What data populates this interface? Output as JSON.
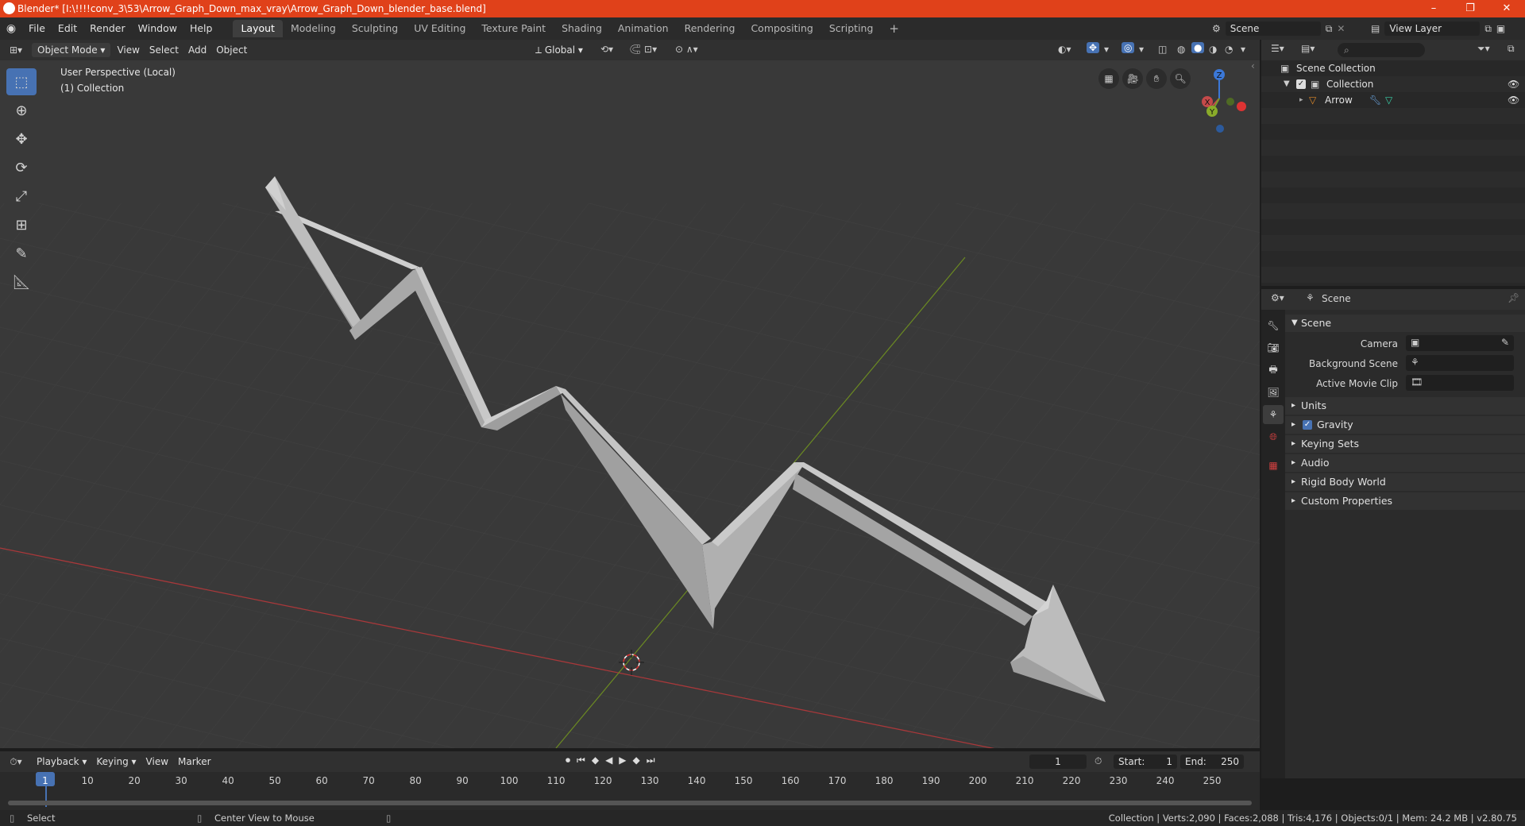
{
  "window": {
    "title": "Blender* [I:\\!!!!conv_3\\53\\Arrow_Graph_Down_max_vray\\Arrow_Graph_Down_blender_base.blend]",
    "controls": [
      "–",
      "❐",
      "✕"
    ]
  },
  "menu": [
    "File",
    "Edit",
    "Render",
    "Window",
    "Help"
  ],
  "workspaces": [
    {
      "label": "Layout",
      "active": true
    },
    {
      "label": "Modeling"
    },
    {
      "label": "Sculpting"
    },
    {
      "label": "UV Editing"
    },
    {
      "label": "Texture Paint"
    },
    {
      "label": "Shading"
    },
    {
      "label": "Animation"
    },
    {
      "label": "Rendering"
    },
    {
      "label": "Compositing"
    },
    {
      "label": "Scripting"
    }
  ],
  "scene_field": "Scene",
  "view_layer_field": "View Layer",
  "viewport_header": {
    "mode": "Object Mode",
    "menus": [
      "View",
      "Select",
      "Add",
      "Object"
    ],
    "transform_orientation": "Global"
  },
  "viewport": {
    "perspective_label": "User Perspective (Local)",
    "collection_label": "(1) Collection",
    "gizmo_axes": [
      "X",
      "Y",
      "Z"
    ]
  },
  "outliner": {
    "root": "Scene Collection",
    "collection": "Collection",
    "object": "Arrow"
  },
  "properties": {
    "header_title": "Scene",
    "section_title": "Scene",
    "fields": [
      {
        "label": "Camera"
      },
      {
        "label": "Background Scene"
      },
      {
        "label": "Active Movie Clip"
      }
    ],
    "subsections": [
      "Units",
      "Gravity",
      "Keying Sets",
      "Audio",
      "Rigid Body World",
      "Custom Properties"
    ]
  },
  "timeline": {
    "menus": [
      "Playback",
      "Keying",
      "View",
      "Marker"
    ],
    "current_frame": "1",
    "start_label": "Start:",
    "start": "1",
    "end_label": "End:",
    "end": "250",
    "ticks": [
      "1",
      "10",
      "20",
      "30",
      "40",
      "50",
      "60",
      "70",
      "80",
      "90",
      "100",
      "110",
      "120",
      "130",
      "140",
      "150",
      "160",
      "170",
      "180",
      "190",
      "200",
      "210",
      "220",
      "230",
      "240",
      "250"
    ]
  },
  "status": {
    "left_action": "Select",
    "middle_action": "Center View to Mouse",
    "stats": "Collection | Verts:2,090 | Faces:2,088 | Tris:4,176 | Objects:0/1 | Mem: 24.2 MB | v2.80.75"
  },
  "colors": {
    "title_bar": "#e0411a",
    "accent": "#4772b3",
    "x_axis": "#c44a4a",
    "y_axis": "#7a9a2a",
    "z_axis": "#3b78d8"
  }
}
